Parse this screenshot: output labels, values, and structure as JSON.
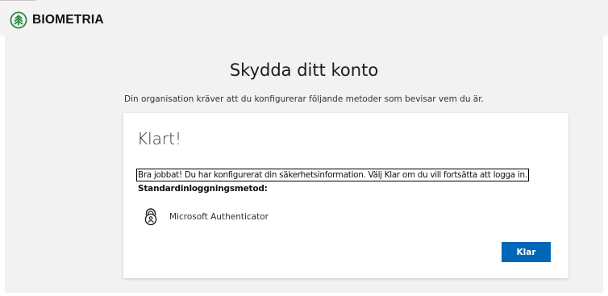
{
  "header": {
    "brand_name": "BIOMETRIA",
    "logo_icon": "tree-circle-logo-icon",
    "brand_color": "#2b8a3e"
  },
  "main": {
    "title": "Skydda ditt konto",
    "subtitle": "Din organisation kräver att du konfigurerar följande metoder som bevisar vem du är."
  },
  "card": {
    "heading": "Klart!",
    "message": "Bra jobbat! Du har konfigurerat din säkerhetsinformation. Välj Klar om du vill fortsätta att logga in.",
    "default_method_label": "Standardinloggningsmetod:",
    "method_icon": "authenticator-lock-icon",
    "method_name": "Microsoft Authenticator",
    "done_button_label": "Klar",
    "button_color": "#0067b8"
  }
}
